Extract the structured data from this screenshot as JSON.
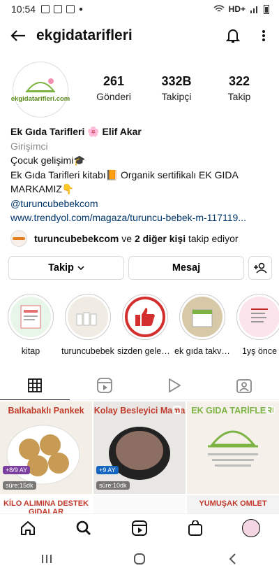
{
  "status_bar": {
    "time": "10:54",
    "network": "HD+"
  },
  "header": {
    "username": "ekgidatarifleri"
  },
  "profile": {
    "avatar_brand": "ekgidatarifleri.com",
    "stats": [
      {
        "value": "261",
        "label": "Gönderi"
      },
      {
        "value": "332B",
        "label": "Takipçi"
      },
      {
        "value": "322",
        "label": "Takip"
      }
    ],
    "bio": {
      "name": "Ek Gıda Tarifleri 🌸 Elif Akar",
      "category": "Girişimci",
      "line1": "Çocuk gelişimi🎓",
      "line2": "Ek Gıda Tarifleri kitabı📙 Organik sertifikalı EK GIDA",
      "line3": "MARKAMIZ👇",
      "mention": "@turuncubebekcom",
      "url": "www.trendyol.com/magaza/turuncu-bebek-m-117119..."
    },
    "followed_by": {
      "user": "turuncubebekcom",
      "connector": " ve ",
      "others": "2 diğer kişi",
      "suffix": " takip ediyor"
    }
  },
  "actions": {
    "follow": "Takip",
    "message": "Mesaj"
  },
  "highlights": [
    {
      "label": "kitap"
    },
    {
      "label": "turuncubebek"
    },
    {
      "label": "sizden gelen..."
    },
    {
      "label": "ek gıda takvi..."
    },
    {
      "label": "1yş önce"
    }
  ],
  "grid": {
    "posts": [
      {
        "title": "Balkabaklı Pankek",
        "sub": "süre:15dk",
        "age": "+8/9 AY"
      },
      {
        "title": "Kolay Besleyici Mama",
        "sub": "süre:10dk",
        "age": "+9 AY"
      },
      {
        "title": "EK GIDA TARİFLERİ",
        "sub": "",
        "age": ""
      }
    ],
    "row2": [
      {
        "title": "KİLO ALIMINA DESTEK GIDALAR"
      },
      {
        "title": ""
      },
      {
        "title": "YUMUŞAK OMLET"
      }
    ]
  },
  "colors": {
    "accent": "#c0392b",
    "link": "#00376b",
    "muted": "#8e8e8e"
  }
}
